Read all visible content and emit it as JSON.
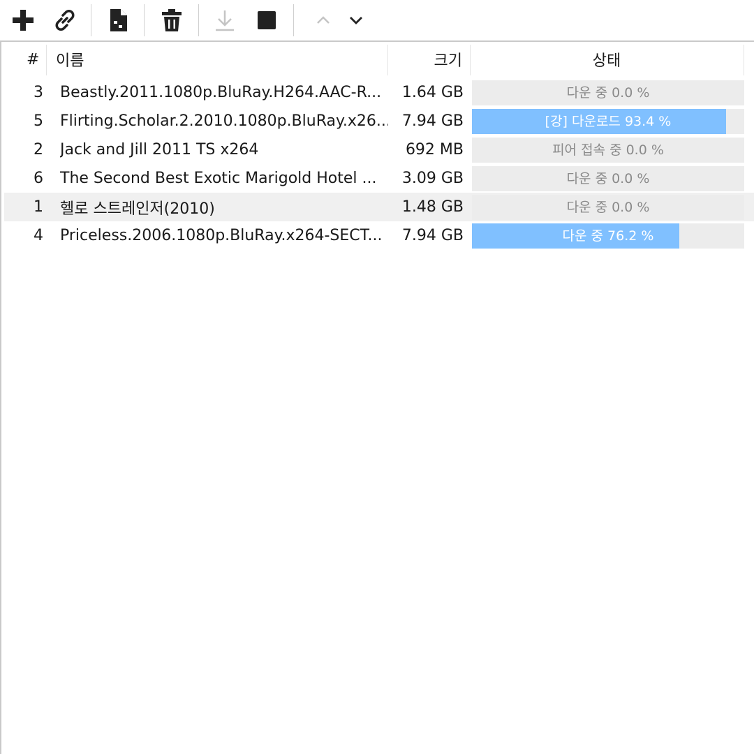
{
  "toolbar": {
    "buttons": [
      {
        "name": "add-torrent-button",
        "icon": "plus-icon"
      },
      {
        "name": "add-link-button",
        "icon": "link-icon"
      },
      {
        "name": "file-button",
        "icon": "file-icon"
      },
      {
        "name": "delete-button",
        "icon": "trash-icon"
      },
      {
        "name": "download-button",
        "icon": "download-arrow-icon",
        "disabled": true
      },
      {
        "name": "stop-button",
        "icon": "stop-square-icon"
      },
      {
        "name": "move-up-button",
        "icon": "chevron-up-icon",
        "disabled": true
      },
      {
        "name": "move-down-button",
        "icon": "chevron-down-icon"
      }
    ]
  },
  "columns": {
    "num": "#",
    "name": "이름",
    "size": "크기",
    "status": "상태"
  },
  "rows": [
    {
      "num": "3",
      "name": "Beastly.2011.1080p.BluRay.H264.AAC-R...",
      "size": "1.64 GB",
      "status": "다운 중 0.0 %",
      "progress": 0.0,
      "selected": false
    },
    {
      "num": "5",
      "name": "Flirting.Scholar.2.2010.1080p.BluRay.x26...",
      "size": "7.94 GB",
      "status": "[강] 다운로드 93.4 %",
      "progress": 93.4,
      "selected": false
    },
    {
      "num": "2",
      "name": "Jack and Jill 2011 TS x264",
      "size": "692 MB",
      "status": "피어 접속 중 0.0 %",
      "progress": 0.0,
      "selected": false
    },
    {
      "num": "6",
      "name": "The Second Best Exotic Marigold Hotel ...",
      "size": "3.09 GB",
      "status": "다운 중 0.0 %",
      "progress": 0.0,
      "selected": false
    },
    {
      "num": "1",
      "name": "헬로 스트레인저(2010)",
      "size": "1.48 GB",
      "status": "다운 중 0.0 %",
      "progress": 0.0,
      "selected": true
    },
    {
      "num": "4",
      "name": "Priceless.2006.1080p.BluRay.x264-SECT...",
      "size": "7.94 GB",
      "status": "다운 중 76.2 %",
      "progress": 76.2,
      "selected": false
    }
  ],
  "colors": {
    "progress_fill": "#80c0ff",
    "progress_track": "#ececec",
    "selected_row": "#f0f0f0"
  }
}
